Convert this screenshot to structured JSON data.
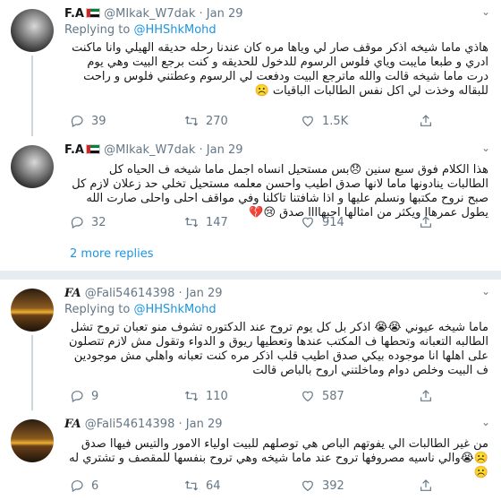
{
  "tweets": [
    {
      "name": "F.A",
      "handle": "@MIkak_W7dak",
      "date": "Jan 29",
      "replying_label": "Replying to",
      "replying_to": "@HHShkMohd",
      "text": "هاذي ماما شيخه اذكر موقف صار لي وياها مره كان عندنا رحله حديقه الهيلي وانا ماكنت ادري و طبعا مايبت وياي فلوس الرسوم للدخول للحديقه و كنت برجع البيت وهي يوم درت ماما شيخه قالت والله ماترجع البيت ودفعت لي الرسوم وعطتني فلوس و راحت للبقاله وخذت لي اكل نفس الطالبات الباقيات ☹️",
      "replies": "39",
      "retweets": "270",
      "likes": "1.5K"
    },
    {
      "name": "F.A",
      "handle": "@MIkak_W7dak",
      "date": "Jan 29",
      "text": "هذا الكلام فوق سبع سنين 😞بس مستحيل انساه اجمل ماما شيخه ف الحياه كل الطالبات ينادونها ماما لانها صدق اطيب واحسن معلمه مستحيل تخلي حد زعلان لازم كل صبح نروح مكتبها ونسلم عليها و اذا شافتنا تاكلنا  وفي مواقف احلى واحلى صارت الله يطول عمرهاا ويكثر من امثالها احبهاااا صدق 😢💔",
      "replies": "32",
      "retweets": "147",
      "likes": "914"
    },
    {
      "name": "FA",
      "handle": "@Fali54614398",
      "date": "Jan 29",
      "replying_label": "Replying to",
      "replying_to": "@HHShkMohd",
      "text": "ماما شيخه عيوني 😭😭 اذكر بل كل يوم تروح عند الدكتوره تشوف منو تعبان تروح تشل الطالبه التعبانه وتحطها ف المكتب عندها وتعطيها ريوق و الدواء وتقول مش لازم تتصلون على اهلها انا موجوده بيكي صدق اطيب قلب اذكر مره كنت تعبانه واهلي مش موجودين ف البيت وخلص دوام وماخلتني اروح بالباص قالت",
      "replies": "9",
      "retweets": "110",
      "likes": "587"
    },
    {
      "name": "FA",
      "handle": "@Fali54614398",
      "date": "Jan 29",
      "text": "من غير الطالبات الي يفوتهم الباص هي توصلهم للبيت اولياء الامور والتيس فيهاا صدق ☹️😭والي ناسيه مصروفها تروح عند ماما شيخه وهي تروح بنفسها للمقصف و تشتري له☹️",
      "replies": "6",
      "retweets": "64",
      "likes": "392"
    }
  ],
  "more_replies": "2 more replies"
}
